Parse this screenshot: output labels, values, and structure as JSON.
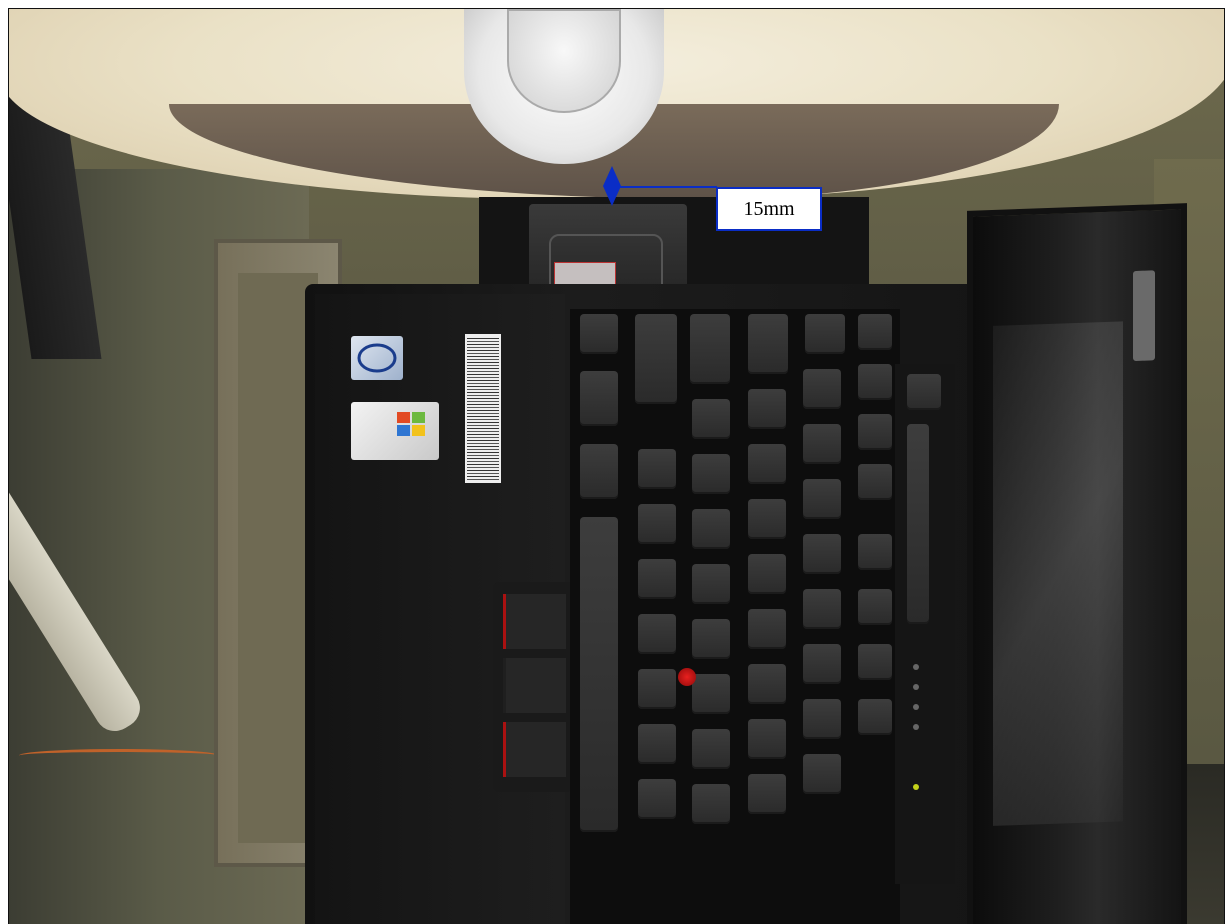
{
  "annotation": {
    "label": "15mm"
  },
  "colors": {
    "annotation": "#0a2dc6",
    "trackpoint": "#e8201f"
  },
  "icons": [
    "intel-sticker",
    "windows-sticker",
    "barcode-label",
    "trackpoint",
    "measurement-arrow"
  ]
}
